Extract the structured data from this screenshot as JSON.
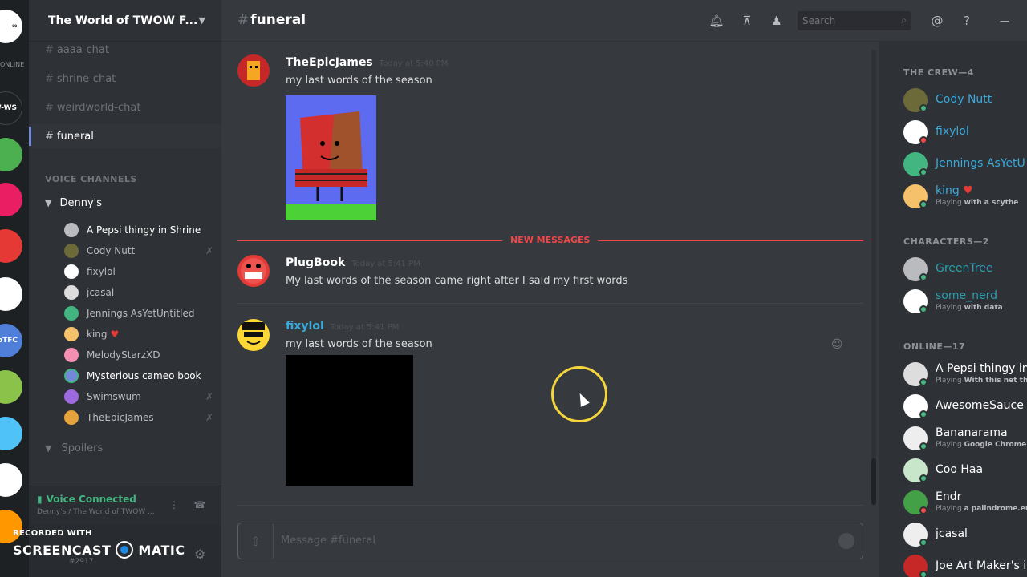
{
  "rail": {
    "servers": [
      {
        "label": "",
        "color": "#ffffff"
      },
      {
        "label": "W-WS",
        "color": "#1e2124"
      },
      {
        "label": "",
        "color": "#4caf50"
      },
      {
        "label": "",
        "color": "#e91e63"
      },
      {
        "label": "",
        "color": "#e53935"
      },
      {
        "label": "",
        "color": "#ffffff"
      },
      {
        "label": "oTFC",
        "color": "#4f7fd8"
      },
      {
        "label": "",
        "color": "#8bc34a"
      },
      {
        "label": "",
        "color": "#4fc3f7"
      },
      {
        "label": "",
        "color": "#ffffff"
      },
      {
        "label": "",
        "color": "#ff9800"
      }
    ],
    "online_label": "ONLINE"
  },
  "sidebar": {
    "guild_name": "The World of TWOW F...",
    "text_channels": [
      {
        "name": "aaaa-chat"
      },
      {
        "name": "shrine-chat"
      },
      {
        "name": "weirdworld-chat"
      },
      {
        "name": "funeral"
      }
    ],
    "voice_category": "VOICE CHANNELS",
    "voice_channel": "Denny's",
    "voice_users": [
      {
        "name": "A Pepsi thingy in Shrine",
        "color": "#b9bbbe"
      },
      {
        "name": "Cody Nutt",
        "color": "#6d6a3a"
      },
      {
        "name": "fixylol",
        "color": "#ffffff"
      },
      {
        "name": "jcasal",
        "color": "#dddddd"
      },
      {
        "name": "Jennings AsYetUntitled",
        "color": "#43b581"
      },
      {
        "name": "king",
        "color": "#f5c26b"
      },
      {
        "name": "MelodyStarzXD",
        "color": "#f48fb1"
      },
      {
        "name": "Mysterious cameo book",
        "color": "#7289da"
      },
      {
        "name": "Swimswum",
        "color": "#9c6ade"
      },
      {
        "name": "TheEpicJames",
        "color": "#e6a23c"
      }
    ],
    "spoilers": "Spoilers",
    "voice_status": "Voice Connected",
    "voice_location": "Denny's / The World of TWOW ...",
    "recorded_with": "RECORDED WITH",
    "screencast_left": "SCREENCAST",
    "screencast_right": "MATIC",
    "user_tag": "#2917"
  },
  "topbar": {
    "channel": "funeral",
    "search_placeholder": "Search"
  },
  "messages": [
    {
      "author": "TheEpicJames",
      "time": "Today at 5:40 PM",
      "text": "my last words of the season",
      "author_color": "#ffffff"
    },
    {
      "author": "PlugBook",
      "time": "Today at 5:41 PM",
      "text": "My last words of the season came right after I said my first words",
      "author_color": "#ffffff"
    },
    {
      "author": "fixylol",
      "time": "Today at 5:41 PM",
      "text": "my last words of the season",
      "author_color": "#3ba9d9"
    }
  ],
  "new_messages_label": "NEW MESSAGES",
  "compose": {
    "placeholder": "Message #funeral"
  },
  "members": {
    "crew_header": "THE CREW—4",
    "crew": [
      {
        "name": "Cody Nutt",
        "status": "",
        "game": "",
        "color": "#3ba9d9"
      },
      {
        "name": "fixylol",
        "status": "",
        "game": "",
        "color": "#3ba9d9"
      },
      {
        "name": "Jennings AsYetU",
        "status": "",
        "game": "",
        "color": "#3ba9d9"
      },
      {
        "name": "king",
        "status": "Playing",
        "game": "with a scythe",
        "color": "#3ba9d9"
      }
    ],
    "characters_header": "CHARACTERS—2",
    "characters": [
      {
        "name": "GreenTree",
        "status": "",
        "game": "",
        "color": "#3ba9d9"
      },
      {
        "name": "some_nerd",
        "status": "Playing",
        "game": "with data",
        "color": "#3ba9d9"
      }
    ],
    "online_header": "ONLINE—17",
    "online": [
      {
        "name": "A Pepsi thingy in",
        "status": "Playing",
        "game": "With this net tha"
      },
      {
        "name": "AwesomeSauce",
        "status": "",
        "game": ""
      },
      {
        "name": "Bananarama",
        "status": "Playing",
        "game": "Google Chrome"
      },
      {
        "name": "Coo Haa",
        "status": "",
        "game": ""
      },
      {
        "name": "Endr",
        "status": "Playing",
        "game": "a palindrome.em"
      },
      {
        "name": "jcasal",
        "status": "",
        "game": ""
      },
      {
        "name": "Joe Art Maker's i",
        "status": "",
        "game": ""
      }
    ]
  }
}
